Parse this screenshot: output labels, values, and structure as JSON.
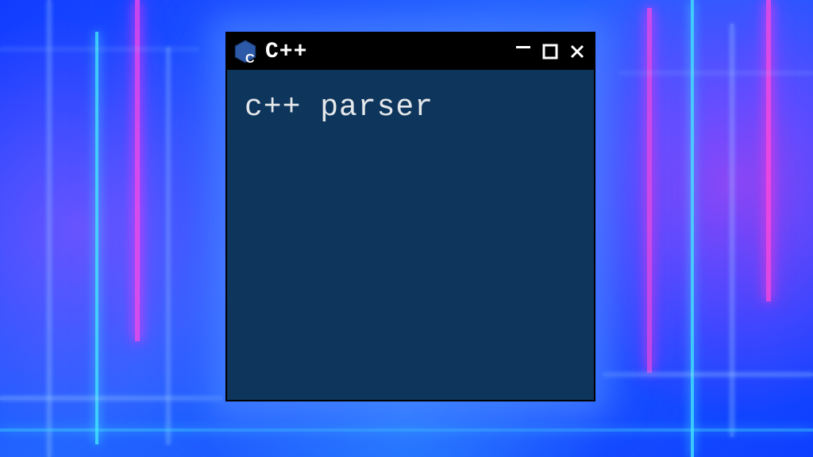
{
  "window": {
    "title": "C++",
    "icon_letter": "C",
    "body_text": "c++ parser",
    "colors": {
      "body_bg": "#0e355c",
      "titlebar_bg": "#000000",
      "text": "#e4e8ea"
    }
  }
}
